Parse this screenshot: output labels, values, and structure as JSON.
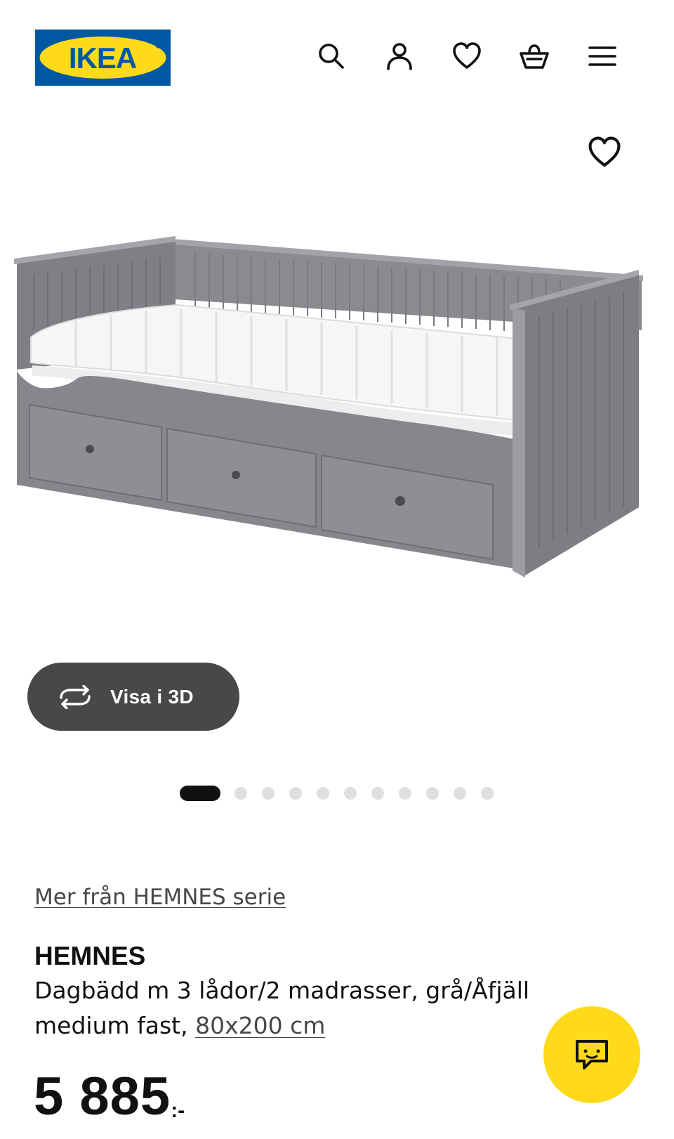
{
  "header": {
    "logo_text": "IKEA",
    "icons": [
      "search-icon",
      "account-icon",
      "favorites-icon",
      "basket-icon",
      "menu-icon"
    ]
  },
  "product_image": {
    "favorite_icon": "heart-outline-icon"
  },
  "viewer": {
    "view_3d_label": "Visa i 3D",
    "icon": "rotate-3d-icon"
  },
  "carousel": {
    "total": 11,
    "active_index": 0
  },
  "product": {
    "series_link": "Mer från HEMNES serie",
    "name": "HEMNES",
    "description": "Dagbädd m 3 lådor/2 madrasser, grå/Åfjäll medium fast,",
    "size_link": "80x200 cm",
    "price_integer": "5 885",
    "price_suffix": ":-"
  },
  "chat": {
    "icon": "chat-bubble-icon"
  },
  "colors": {
    "ikea_blue": "#0058a3",
    "ikea_yellow": "#ffda1a",
    "button_dark": "#484848",
    "text": "#111111"
  }
}
